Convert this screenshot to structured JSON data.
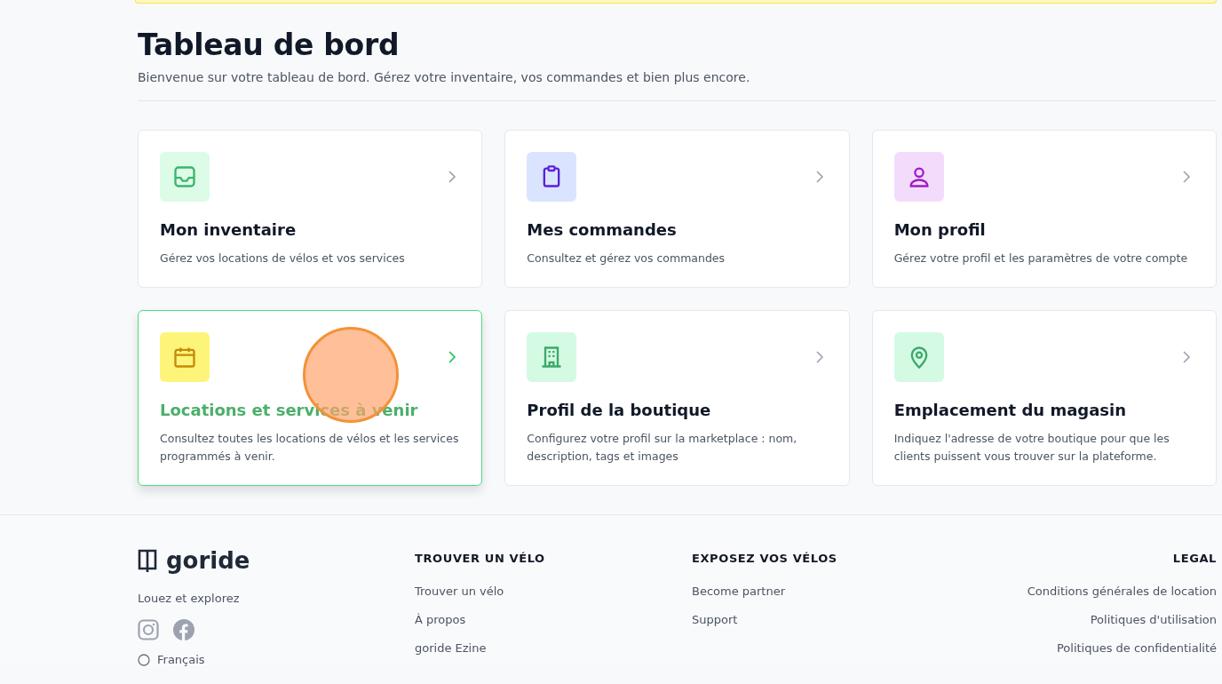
{
  "header": {
    "title": "Tableau de bord",
    "subtitle": "Bienvenue sur votre tableau de bord. Gérez votre inventaire, vos commandes et bien plus encore."
  },
  "cards": [
    {
      "title": "Mon inventaire",
      "description": "Gérez vos locations de vélos et vos services",
      "hovered": false
    },
    {
      "title": "Mes commandes",
      "description": "Consultez et gérez vos commandes",
      "hovered": false
    },
    {
      "title": "Mon profil",
      "description": "Gérez votre profil et les paramètres de votre compte",
      "hovered": false
    },
    {
      "title": "Locations et services à venir",
      "description": "Consultez toutes les locations de vélos et les services programmés à venir.",
      "hovered": true
    },
    {
      "title": "Profil de la boutique",
      "description": "Configurez votre profil sur la marketplace : nom, description, tags et images",
      "hovered": false
    },
    {
      "title": "Emplacement du magasin",
      "description": "Indiquez l'adresse de votre boutique pour que les clients puissent vous trouver sur la plateforme.",
      "hovered": false
    }
  ],
  "footer": {
    "brand": "goride",
    "tagline": "Louez et explorez",
    "language": "Français",
    "columns": [
      {
        "heading": "TROUVER UN VÉLO",
        "links": [
          "Trouver un vélo",
          "À propos",
          "goride Ezine"
        ]
      },
      {
        "heading": "EXPOSEZ VOS VÉLOS",
        "links": [
          "Become partner",
          "Support"
        ]
      },
      {
        "heading": "LEGAL",
        "links": [
          "Conditions générales de location",
          "Politiques d'utilisation",
          "Politiques de confidentialité"
        ]
      }
    ]
  }
}
